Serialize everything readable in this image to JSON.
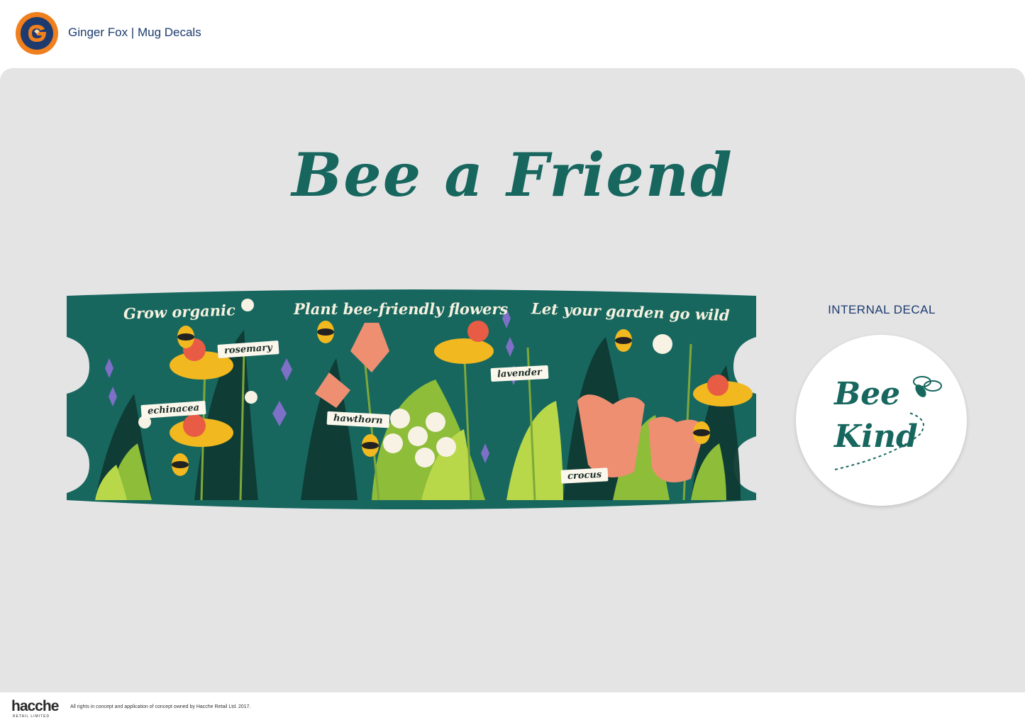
{
  "header": {
    "title": "Ginger Fox | Mug Decals",
    "logo_icon": "ginger-fox-logo-icon",
    "logo_color": "#f07f1e"
  },
  "main": {
    "title": "Bee a Friend",
    "title_color": "#17675f",
    "background_color": "#e4e4e5"
  },
  "decal": {
    "background_color": "#17675f",
    "slogans": [
      "Grow organic",
      "Plant bee-friendly flowers",
      "Let your garden go wild"
    ],
    "flower_labels": [
      "rosemary",
      "echinacea",
      "hawthorn",
      "lavender",
      "crocus"
    ]
  },
  "internal_decal": {
    "label": "INTERNAL DECAL",
    "line1": "Bee",
    "line2": "Kind",
    "icon": "bee-icon"
  },
  "footer": {
    "logo": "hacche",
    "logo_sub": "RETAIL LIMITED",
    "copyright": "All rights in concept and application of concept owned by Hacche Retail Ltd. 2017."
  }
}
